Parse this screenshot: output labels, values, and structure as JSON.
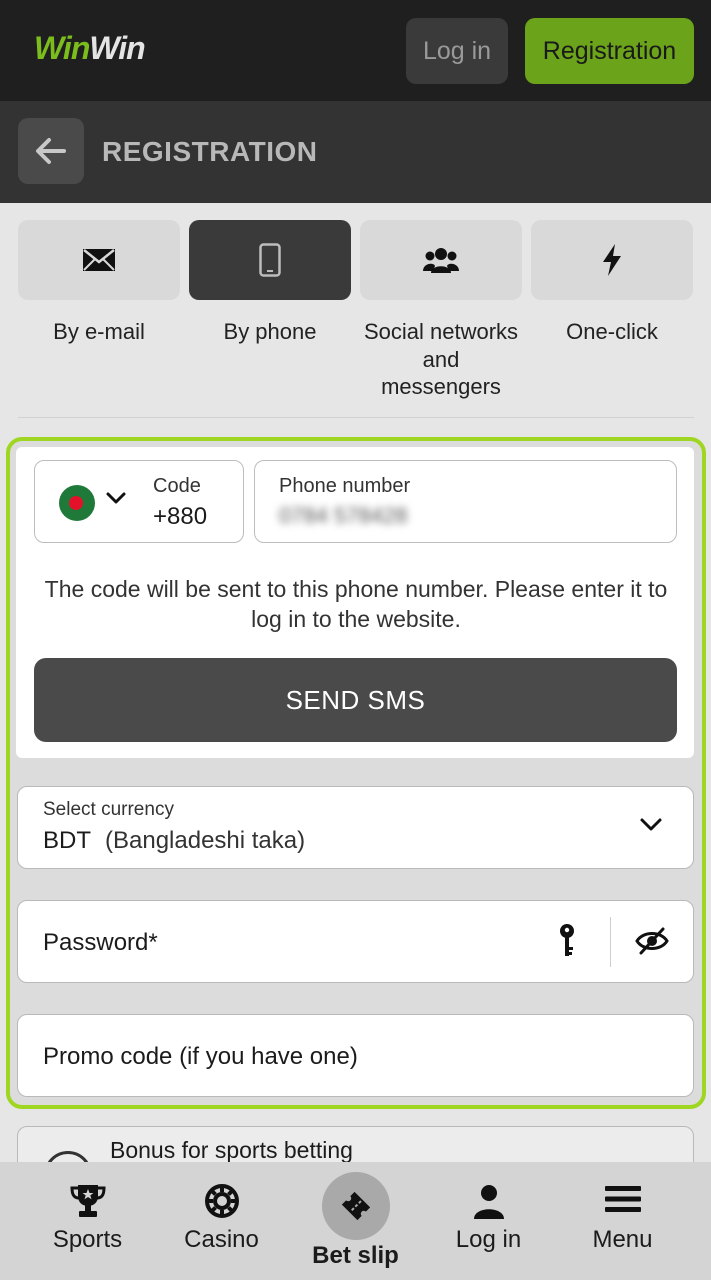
{
  "header": {
    "logo_part1": "Win",
    "logo_part2": "Win",
    "login_label": "Log in",
    "registration_label": "Registration",
    "accent_color": "#6ba31a"
  },
  "subheader": {
    "title": "REGISTRATION"
  },
  "methods": [
    {
      "label": "By e-mail",
      "icon": "envelope-icon",
      "active": false
    },
    {
      "label": "By phone",
      "icon": "smartphone-icon",
      "active": true
    },
    {
      "label": "Social networks and messengers",
      "icon": "users-icon",
      "active": false
    },
    {
      "label": "One-click",
      "icon": "lightning-icon",
      "active": false
    }
  ],
  "form": {
    "code_label": "Code",
    "code_value": "+880",
    "country_flag": "bangladesh-flag-icon",
    "phone_label": "Phone number",
    "phone_value": "0784 578428",
    "hint": "The code will be sent to this phone number. Please enter it to log in to the website.",
    "send_sms_label": "SEND SMS",
    "currency_label": "Select currency",
    "currency_code": "BDT",
    "currency_name": "(Bangladeshi taka)",
    "password_label": "Password*",
    "promo_label": "Promo code (if you have one)",
    "outline_color": "#9fd622"
  },
  "bonus": {
    "label": "Bonus for sports betting"
  },
  "bottom_nav": {
    "sports": "Sports",
    "casino": "Casino",
    "bet_slip": "Bet slip",
    "log_in": "Log in",
    "menu": "Menu"
  }
}
